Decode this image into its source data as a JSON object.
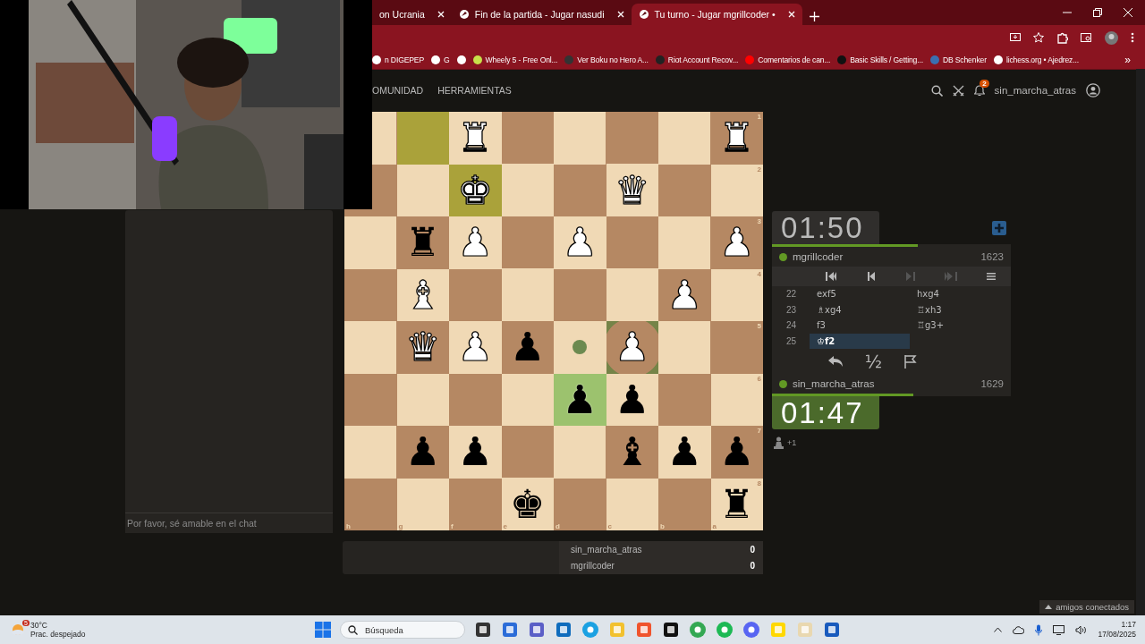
{
  "browser": {
    "tabs": [
      {
        "title": "on Ucrania",
        "selected": false
      },
      {
        "title": "Fin de la partida - Jugar nasudi",
        "selected": false
      },
      {
        "title": "Tu turno - Jugar mgrillcoder •",
        "selected": true
      }
    ],
    "bookmarks": [
      {
        "label": "n DIGEPEP",
        "kind": "page"
      },
      {
        "label": "G",
        "kind": "google"
      },
      {
        "kind": "globe"
      },
      {
        "label": "Wheely 5 - Free Onl...",
        "kind": "game"
      },
      {
        "label": "Ver Boku no Hero A...",
        "kind": "anime"
      },
      {
        "label": "Riot Account Recov...",
        "kind": "riot"
      },
      {
        "label": "Comentarios de can...",
        "kind": "youtube"
      },
      {
        "label": "Basic Skills / Getting...",
        "kind": "skills"
      },
      {
        "label": "DB Schenker",
        "kind": "db"
      },
      {
        "label": "lichess.org • Ajedrez...",
        "kind": "lichess"
      }
    ],
    "more": "»"
  },
  "header": {
    "nav": [
      "OMUNIDAD",
      "HERRAMIENTAS"
    ],
    "notifications": "2",
    "username": "sin_marcha_atras"
  },
  "chat": {
    "placeholder": "Por favor, sé amable en el chat"
  },
  "board": {
    "ranks": [
      "1",
      "2",
      "3",
      "4",
      "5",
      "6",
      "7",
      "8"
    ],
    "files": [
      "h",
      "g",
      "f",
      "e",
      "d",
      "c",
      "b",
      "a"
    ],
    "rows": [
      [
        null,
        {
          "last_move": true
        },
        {
          "piece": "♜",
          "kind": "white"
        },
        null,
        null,
        null,
        null,
        {
          "piece": "♜",
          "kind": "white"
        }
      ],
      [
        null,
        null,
        {
          "piece": "♚",
          "kind": "white",
          "last_move": true
        },
        null,
        null,
        {
          "piece": "♛",
          "kind": "white"
        },
        null,
        null
      ],
      [
        null,
        {
          "piece": "♜",
          "kind": "black"
        },
        {
          "piece": "♟",
          "kind": "white"
        },
        null,
        {
          "piece": "♟",
          "kind": "white"
        },
        null,
        null,
        {
          "piece": "♟",
          "kind": "white"
        }
      ],
      [
        null,
        {
          "piece": "♝",
          "kind": "white"
        },
        null,
        null,
        null,
        null,
        {
          "piece": "♟",
          "kind": "white"
        },
        null
      ],
      [
        null,
        {
          "piece": "♛",
          "kind": "white"
        },
        {
          "piece": "♟",
          "kind": "white"
        },
        {
          "piece": "♟",
          "kind": "black"
        },
        {
          "move_hint": true
        },
        {
          "piece": "♟",
          "kind": "white",
          "capture_hint": true
        },
        null,
        null
      ],
      [
        null,
        null,
        null,
        null,
        {
          "piece": "♟",
          "kind": "black",
          "selected": true
        },
        {
          "piece": "♟",
          "kind": "black"
        },
        null,
        null
      ],
      [
        null,
        {
          "piece": "♟",
          "kind": "black"
        },
        {
          "piece": "♟",
          "kind": "black"
        },
        null,
        null,
        {
          "piece": "♝",
          "kind": "black"
        },
        {
          "piece": "♟",
          "kind": "black"
        },
        {
          "piece": "♟",
          "kind": "black"
        }
      ],
      [
        null,
        null,
        null,
        {
          "piece": "♚",
          "kind": "black"
        },
        null,
        null,
        null,
        {
          "piece": "♜",
          "kind": "black"
        }
      ]
    ]
  },
  "crosstable": [
    {
      "name": "sin_marcha_atras",
      "score": "0"
    },
    {
      "name": "mgrillcoder",
      "score": "0"
    }
  ],
  "game": {
    "top": {
      "clock": "01:50",
      "running": false,
      "level": 0.61,
      "name": "mgrillcoder",
      "rating": "1623",
      "online": true
    },
    "bottom": {
      "clock": "01:47",
      "running": true,
      "level": 0.59,
      "name": "sin_marcha_atras",
      "rating": "1629",
      "online": true
    },
    "nav": [
      {
        "kind": "first",
        "disabled": false
      },
      {
        "kind": "prev",
        "disabled": false
      },
      {
        "kind": "next",
        "disabled": true
      },
      {
        "kind": "last",
        "disabled": true
      },
      {
        "kind": "menu",
        "disabled": false
      }
    ],
    "moves": [
      {
        "number": "22",
        "plies": [
          {
            "san": "exf5",
            "selected": false
          },
          {
            "san": "hxg4",
            "selected": false
          }
        ]
      },
      {
        "number": "23",
        "plies": [
          {
            "san": "♗xg4",
            "selected": false
          },
          {
            "san": "♖xh3",
            "selected": false
          }
        ]
      },
      {
        "number": "24",
        "plies": [
          {
            "san": "f3",
            "selected": false
          },
          {
            "san": "♖g3+",
            "selected": false
          }
        ]
      },
      {
        "number": "25",
        "plies": [
          {
            "san": "♔f2",
            "selected": true
          }
        ]
      }
    ],
    "draw": "½",
    "material": "+1"
  },
  "friends": "amigos conectados",
  "taskbar": {
    "weather": {
      "badge": "5",
      "temp": "30°C",
      "condition": "Prac. despejado"
    },
    "search": "Búsqueda",
    "apps": [
      {
        "kind": "taskview"
      },
      {
        "kind": "store"
      },
      {
        "kind": "teams"
      },
      {
        "kind": "outlook"
      },
      {
        "kind": "edge"
      },
      {
        "kind": "files"
      },
      {
        "kind": "brave"
      },
      {
        "kind": "tiktok"
      },
      {
        "kind": "chrome"
      },
      {
        "kind": "spotify"
      },
      {
        "kind": "discord"
      },
      {
        "kind": "notes"
      },
      {
        "kind": "game"
      },
      {
        "kind": "word"
      }
    ],
    "time": "1:17",
    "date": "17/08/2025"
  }
}
